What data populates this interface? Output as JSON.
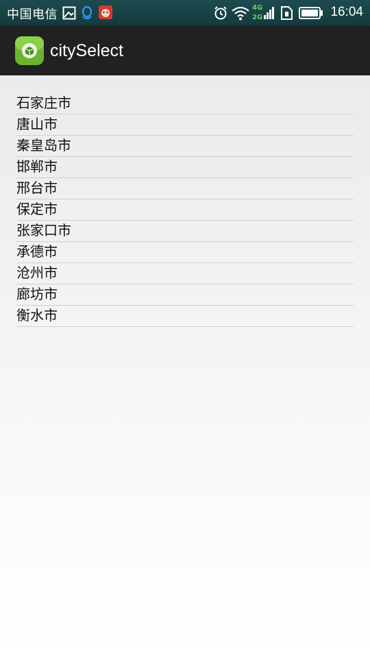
{
  "status_bar": {
    "carrier": "中国电信",
    "time": "16:04",
    "network_label_top": "4G",
    "network_label_bottom": "2G"
  },
  "action_bar": {
    "app_title": "citySelect"
  },
  "city_list": {
    "items": [
      "石家庄市",
      "唐山市",
      "秦皇岛市",
      "邯郸市",
      "邢台市",
      "保定市",
      "张家口市",
      "承德市",
      "沧州市",
      "廊坊市",
      "衡水市"
    ]
  }
}
